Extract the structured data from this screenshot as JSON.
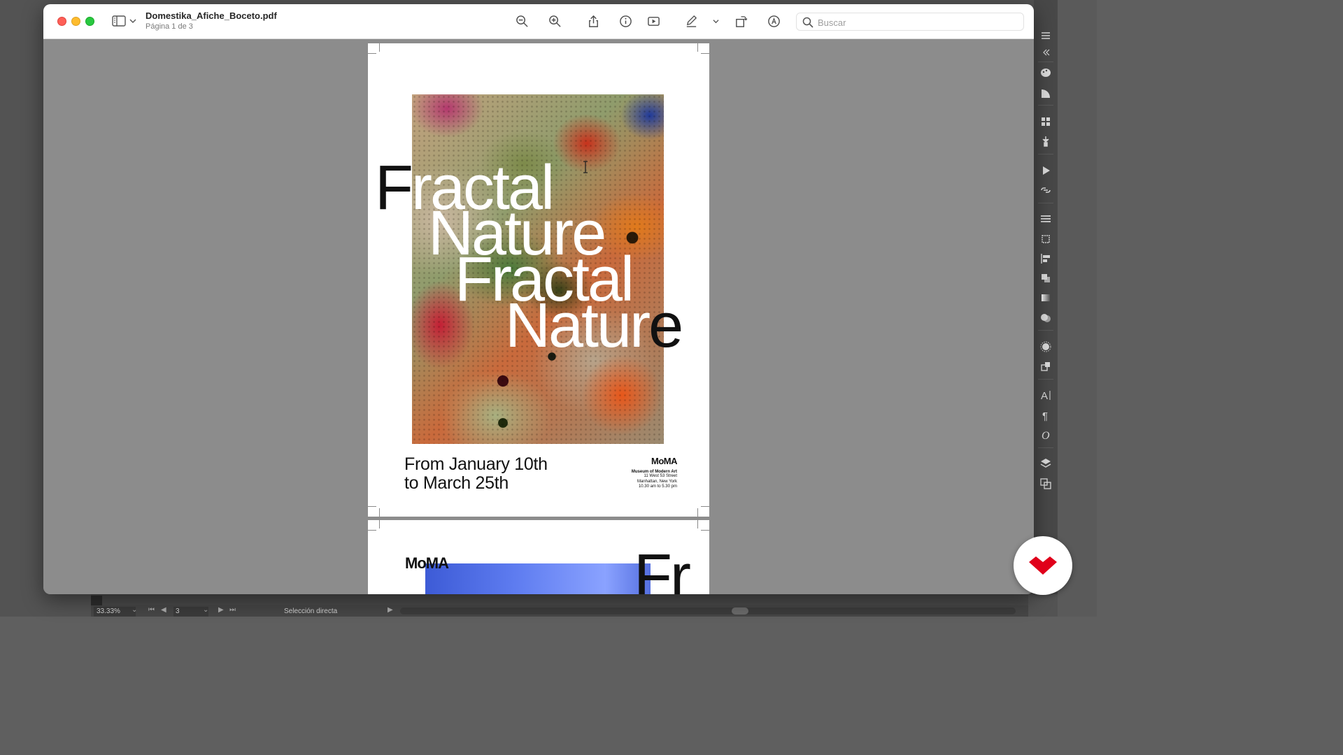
{
  "window": {
    "doc_title": "Domestika_Afiche_Boceto.pdf",
    "page_indicator": "Página 1 de 3",
    "search_placeholder": "Buscar"
  },
  "toolbar": {
    "buttons": [
      "zoom-out-icon",
      "zoom-in-icon",
      "share-icon",
      "info-icon",
      "slideshow-icon",
      "markup-pen-icon",
      "chevron-down-icon",
      "rotate-icon",
      "annotate-icon"
    ]
  },
  "page1": {
    "headline_lines": [
      {
        "dark": "F",
        "light": "ractal",
        "dark2": ""
      },
      {
        "dark": "",
        "light": "Nature",
        "dark2": ""
      },
      {
        "dark": "",
        "light": "Fractal",
        "dark2": ""
      },
      {
        "dark": "",
        "light": "Natur",
        "dark2": "e"
      }
    ],
    "dates_line1": "From January 10th",
    "dates_line2": "to March 25th",
    "moma": {
      "logo": "MoMA",
      "name": "Museum of Modern Art",
      "address1": "11 West 53 Street",
      "address2": "Manhattan, New York",
      "hours": "10.30 am to 5.30 pm"
    }
  },
  "page2": {
    "logo": "MoMA",
    "headline_partial": "Fr"
  },
  "status": {
    "zoom": "33.33%",
    "page": "3",
    "tool": "Selección directa"
  },
  "colors": {
    "close": "#fe5f57",
    "minimize": "#febc2e",
    "maximize": "#28c840",
    "badge": "#e0001a"
  }
}
